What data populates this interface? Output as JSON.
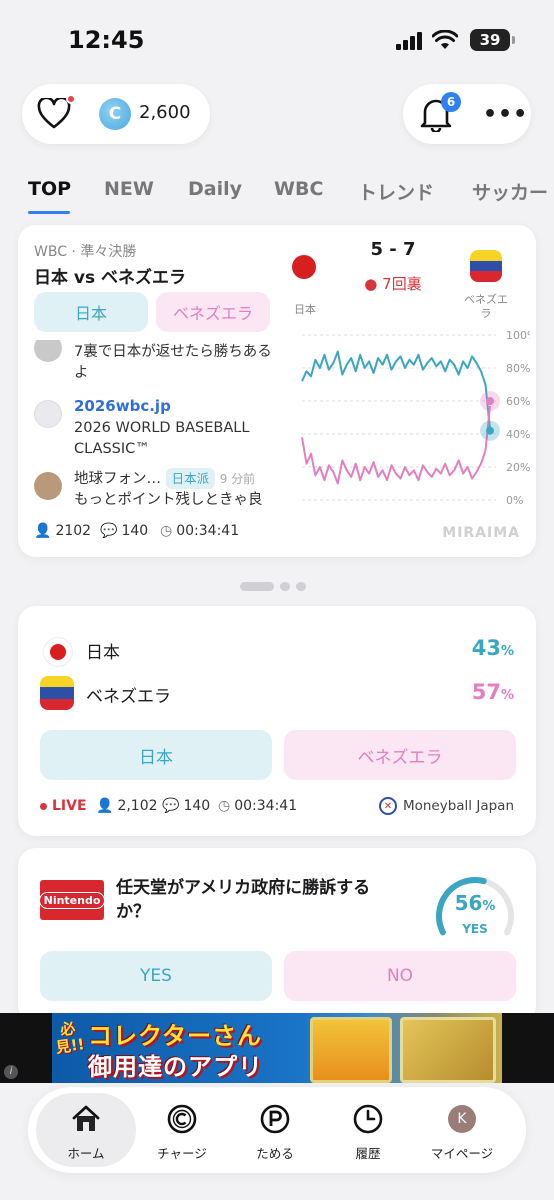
{
  "status_bar": {
    "time": "12:45",
    "battery": "39"
  },
  "header": {
    "coins": "2,600",
    "coin_symbol": "C",
    "notification_count": "6"
  },
  "tabs": [
    "TOP",
    "NEW",
    "Daily",
    "WBC",
    "トレンド",
    "サッカー"
  ],
  "match_card": {
    "subtitle": "WBC · 準々決勝",
    "title": "日本 vs ベネズエラ",
    "team_a": "日本",
    "team_b": "ベネズエラ",
    "score": "5 - 7",
    "inning": "7回裏",
    "team_a_label": "日本",
    "team_b_label": "ベネズエラ",
    "feed": [
      {
        "text": "7裏で日本が返せたら勝ちあるよ"
      },
      {
        "link": "2026wbc.jp",
        "text": "2026 WORLD BASEBALL CLASSIC™"
      },
      {
        "user": "地球フォン…",
        "tag": "日本派",
        "ago": "9 分前",
        "text": "もっとポイント残しときゃ良"
      }
    ],
    "chart_axis": [
      "100%",
      "80%",
      "60%",
      "40%",
      "20%",
      "0%"
    ],
    "users": "2102",
    "comments": "140",
    "elapsed": "00:34:41",
    "brand": "MIRAIMA"
  },
  "chart_data": {
    "type": "line",
    "ylim": [
      0,
      100
    ],
    "y_ticks": [
      "100%",
      "80%",
      "60%",
      "40%",
      "20%",
      "0%"
    ],
    "series": [
      {
        "values": [
          72,
          78,
          75,
          85,
          80,
          88,
          79,
          83,
          90,
          76,
          82,
          86,
          78,
          88,
          80,
          84,
          77,
          86,
          82,
          88,
          79,
          84,
          87,
          80,
          85,
          82,
          88,
          79,
          83,
          86,
          81,
          84,
          78,
          85,
          82,
          76,
          84,
          80,
          87,
          83,
          78,
          70,
          43
        ]
      },
      {
        "values": [
          38,
          22,
          28,
          15,
          20,
          12,
          21,
          17,
          10,
          24,
          18,
          14,
          22,
          12,
          20,
          16,
          23,
          14,
          18,
          12,
          21,
          16,
          13,
          20,
          15,
          18,
          12,
          21,
          17,
          14,
          19,
          16,
          22,
          15,
          18,
          24,
          16,
          20,
          13,
          17,
          22,
          30,
          57
        ]
      }
    ],
    "end_values": {
      "upper": 60,
      "lower": 42
    },
    "colors": {
      "jp": "#3aa6c3",
      "ve": "#e37ec0"
    }
  },
  "vote_card": {
    "team_a": "日本",
    "team_a_pct": "43",
    "team_b": "ベネズエラ",
    "team_b_pct": "57",
    "pct_unit": "%",
    "btn_a": "日本",
    "btn_b": "ベネズエラ",
    "live": "LIVE",
    "users": "2,102",
    "comments": "140",
    "elapsed": "00:34:41",
    "provider": "Moneyball Japan"
  },
  "question_card": {
    "brand": "Nintendo",
    "question": "任天堂がアメリカ政府に勝訴するか？",
    "yes_pct": "56",
    "pct_unit": "%",
    "gauge_fill": 0.56,
    "gauge_label": "YES",
    "btn_yes": "YES",
    "btn_no": "NO"
  },
  "ad": {
    "must": "必見!!",
    "line1": "コレクターさん",
    "line2": "御用達のアプリ",
    "info": "i"
  },
  "bottom_nav": [
    {
      "label": "ホーム",
      "icon": "home-icon"
    },
    {
      "label": "チャージ",
      "icon": "coin-icon"
    },
    {
      "label": "ためる",
      "icon": "points-icon"
    },
    {
      "label": "履歴",
      "icon": "history-icon"
    },
    {
      "label": "マイページ",
      "icon": "profile-icon",
      "avatar": "K"
    }
  ]
}
